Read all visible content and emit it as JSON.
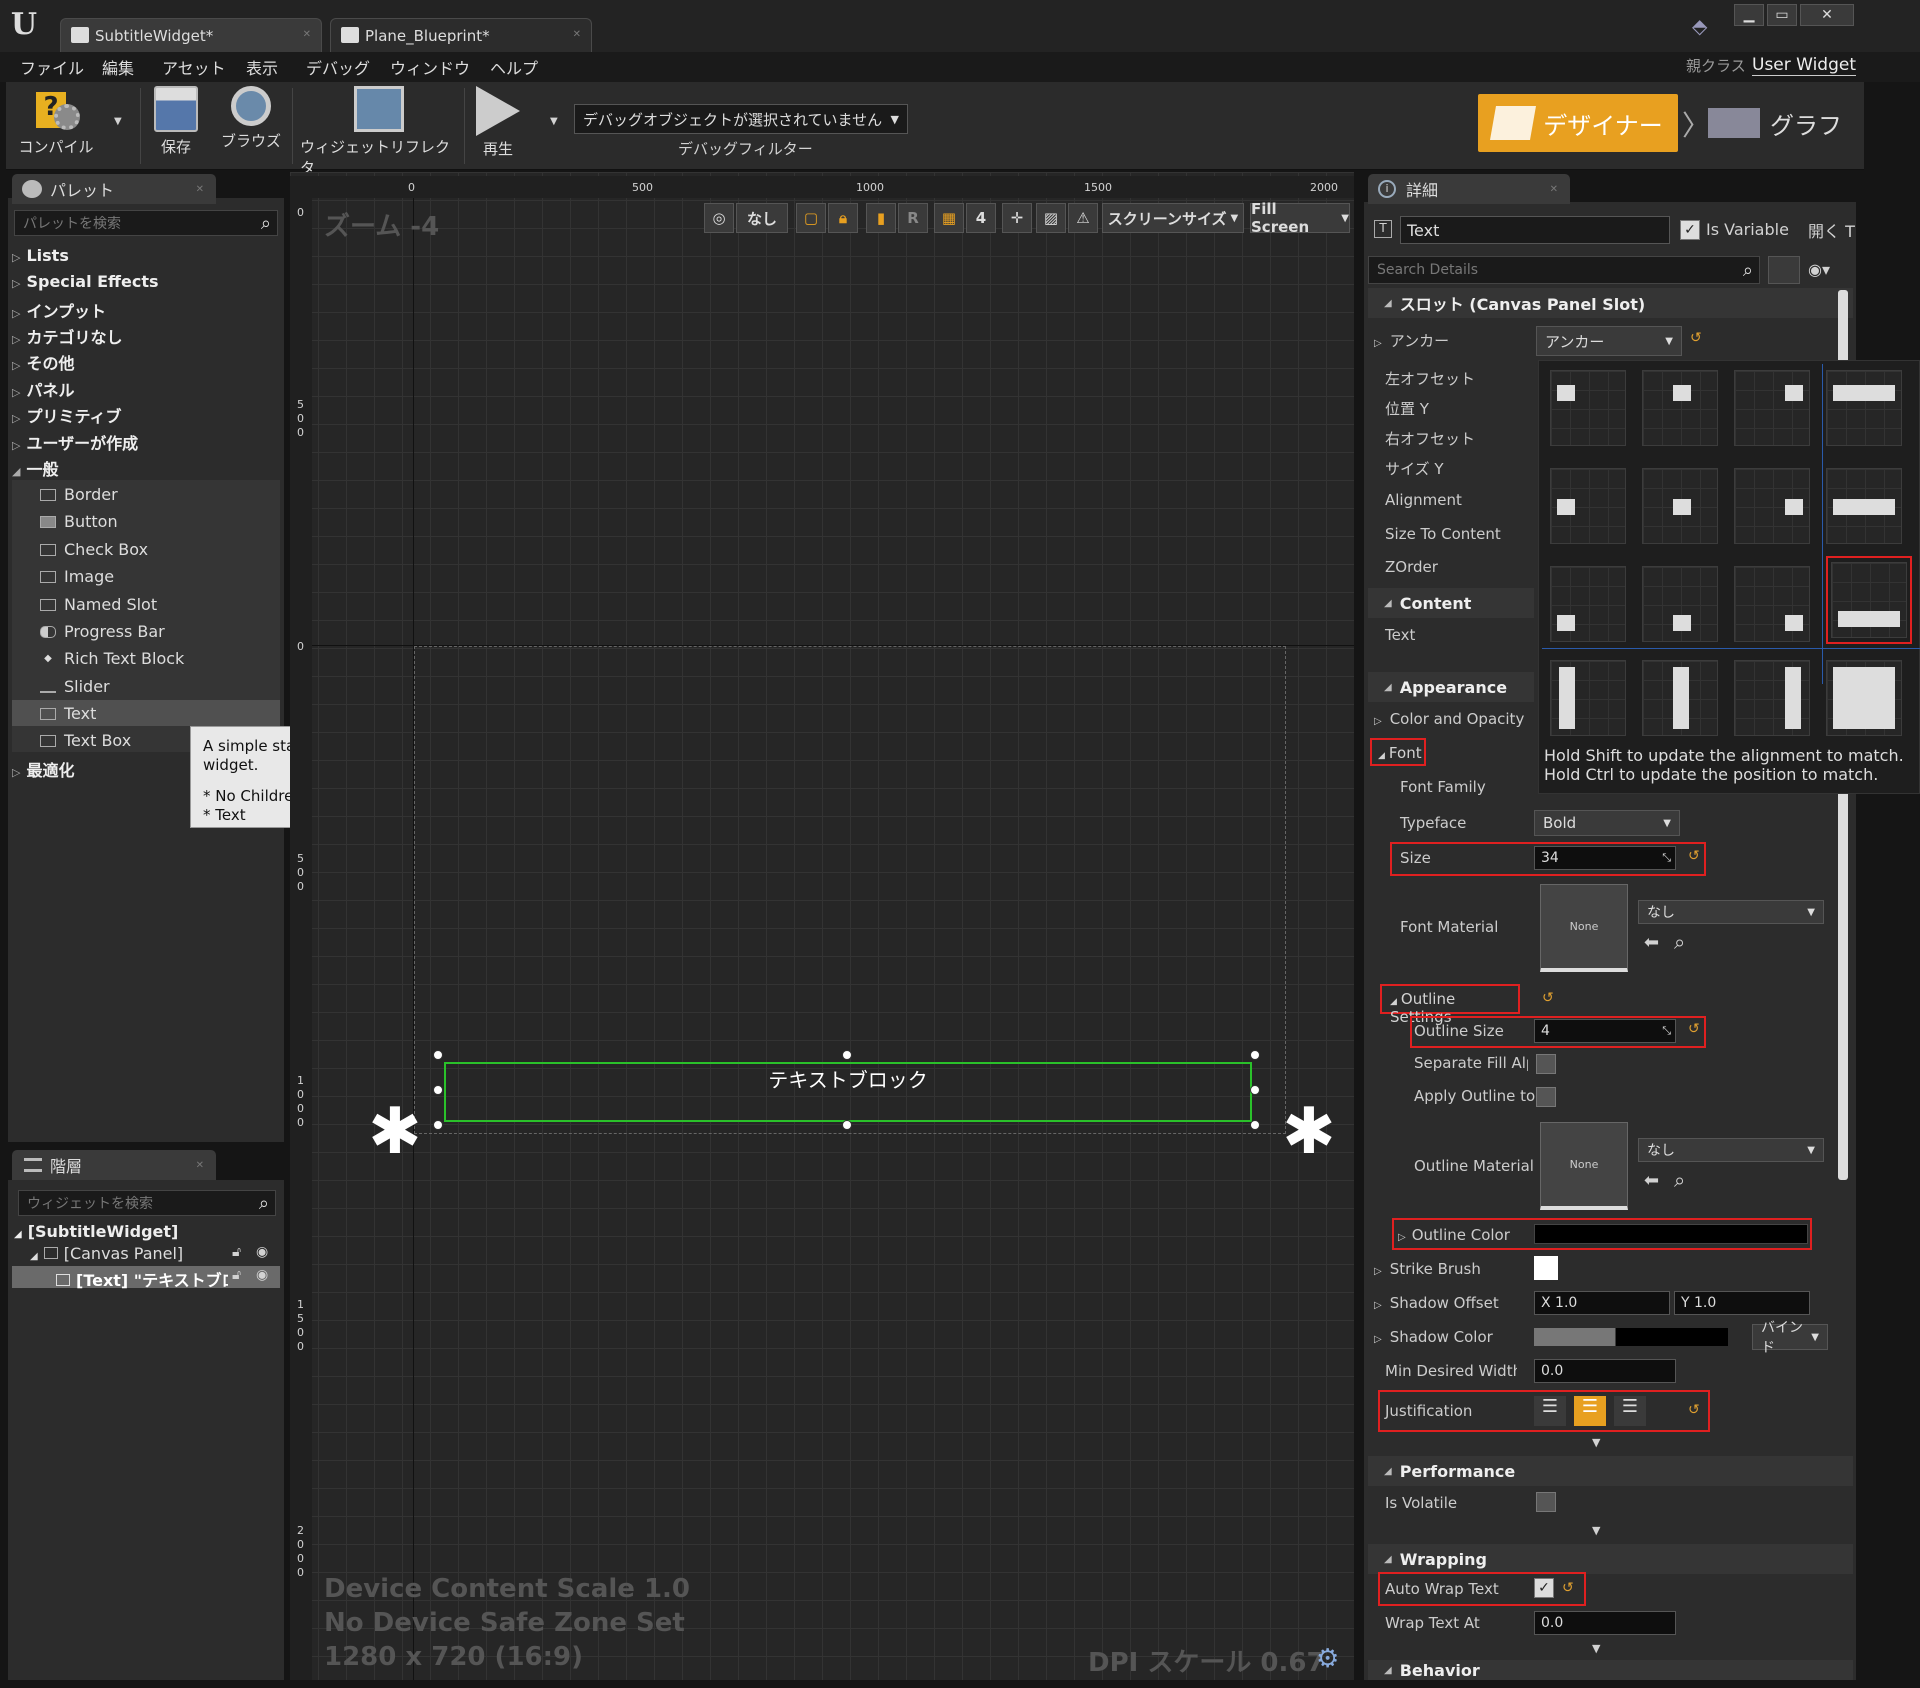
{
  "tabs": [
    {
      "label": "SubtitleWidget*"
    },
    {
      "label": "Plane_Blueprint*"
    }
  ],
  "menu": [
    "ファイル",
    "編集",
    "アセット",
    "表示",
    "デバッグ",
    "ウィンドウ",
    "ヘルプ"
  ],
  "parent_class": {
    "label": "親クラス",
    "value": "User Widget"
  },
  "toolbar": {
    "compile": "コンパイル",
    "save": "保存",
    "browse": "ブラウズ",
    "reflector": "ウィジェットリフレクタ",
    "play": "再生",
    "debug_object": "デバッグオブジェクトが選択されていません",
    "debug_filter": "デバッグフィルター",
    "designer": "デザイナー",
    "graph": "グラフ"
  },
  "palette": {
    "tab": "パレット",
    "search_placeholder": "パレットを検索",
    "categories": [
      "Lists",
      "Special Effects",
      "インプット",
      "カテゴリなし",
      "その他",
      "パネル",
      "プリミティブ",
      "ユーザーが作成",
      "一般"
    ],
    "items": [
      "Border",
      "Button",
      "Check Box",
      "Image",
      "Named Slot",
      "Progress Bar",
      "Rich Text Block",
      "Slider",
      "Text",
      "Text Box"
    ],
    "last_category": "最適化",
    "tooltip": {
      "title": "A simple static text widget.",
      "line1": "* No Children",
      "line2": "* Text"
    }
  },
  "hierarchy": {
    "tab": "階層",
    "search_placeholder": "ウィジェットを検索",
    "root": "[SubtitleWidget]",
    "canvas": "[Canvas Panel]",
    "text": "[Text] \"テキストブロ"
  },
  "viewport": {
    "zoom": "ズーム -4",
    "none_btn": "なし",
    "r_btn": "R",
    "grid_num": "4",
    "screen_size": "スクリーンサイズ",
    "fill_screen": "Fill Screen",
    "ruler_top": [
      "0",
      "500",
      "1000",
      "1500",
      "2000"
    ],
    "ruler_left": [
      "0",
      "500",
      "0",
      "500",
      "1000",
      "1500",
      "2000"
    ],
    "text_block": "テキストブロック",
    "device_scale": "Device Content Scale 1.0",
    "safe_zone": "No Device Safe Zone Set",
    "resolution": "1280 x 720 (16:9)",
    "dpi": "DPI スケール 0.67"
  },
  "details": {
    "tab": "詳細",
    "name": "Text",
    "is_variable": "Is Variable",
    "open_short": "開く T",
    "search_placeholder": "Search Details",
    "slot_section": "スロット (Canvas Panel Slot)",
    "anchor_label": "アンカー",
    "anchor_value": "アンカー",
    "slot_rows": [
      "左オフセット",
      "位置 Y",
      "右オフセット",
      "サイズ Y",
      "Alignment",
      "Size To Content",
      "ZOrder"
    ],
    "content_section": "Content",
    "content_text": "Text",
    "appearance_section": "Appearance",
    "color_opacity": "Color and Opacity",
    "font": "Font",
    "font_family": "Font Family",
    "typeface": "Typeface",
    "typeface_value": "Bold",
    "size": "Size",
    "size_value": "34",
    "font_material": "Font Material",
    "none": "None",
    "nashi": "なし",
    "outline_settings": "Outline Settings",
    "outline_size": "Outline Size",
    "outline_size_value": "4",
    "separate_fill": "Separate Fill Alpha",
    "apply_outline": "Apply Outline to",
    "outline_material": "Outline Material",
    "outline_color": "Outline Color",
    "strike_brush": "Strike Brush",
    "shadow_offset": "Shadow Offset",
    "shadow_x": "X  1.0",
    "shadow_y": "Y  1.0",
    "shadow_color": "Shadow Color",
    "bind": "バインド",
    "min_desired_width": "Min Desired Width",
    "min_desired_value": "0.0",
    "justification": "Justification",
    "performance_section": "Performance",
    "is_volatile": "Is Volatile",
    "wrapping_section": "Wrapping",
    "auto_wrap": "Auto Wrap Text",
    "wrap_text_at": "Wrap Text At",
    "wrap_text_value": "0.0",
    "behavior_section": "Behavior"
  },
  "anchor_popup": {
    "hint1": "Hold Shift to update the alignment to match.",
    "hint2": "Hold Ctrl to update the position to match."
  },
  "colors": {
    "accent": "#e8a020",
    "selection": "#2ac12a",
    "highlight_red": "#e02020"
  }
}
